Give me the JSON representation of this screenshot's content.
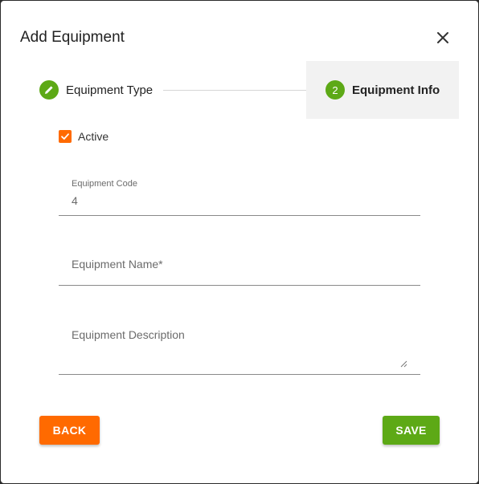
{
  "dialog": {
    "title": "Add Equipment"
  },
  "stepper": {
    "step1": {
      "label": "Equipment Type",
      "status": "completed"
    },
    "step2": {
      "number": "2",
      "label": "Equipment Info",
      "status": "active"
    }
  },
  "form": {
    "active": {
      "label": "Active",
      "checked": true
    },
    "code": {
      "label": "Equipment Code",
      "value": "4"
    },
    "name": {
      "placeholder": "Equipment Name*"
    },
    "description": {
      "placeholder": "Equipment Description"
    }
  },
  "actions": {
    "back_label": "BACK",
    "save_label": "SAVE"
  },
  "colors": {
    "accent_orange": "#ff6a00",
    "accent_green": "#5da916"
  },
  "icons": {
    "close": "close-icon",
    "step1": "pencil-icon",
    "checkbox": "checkmark-icon"
  }
}
